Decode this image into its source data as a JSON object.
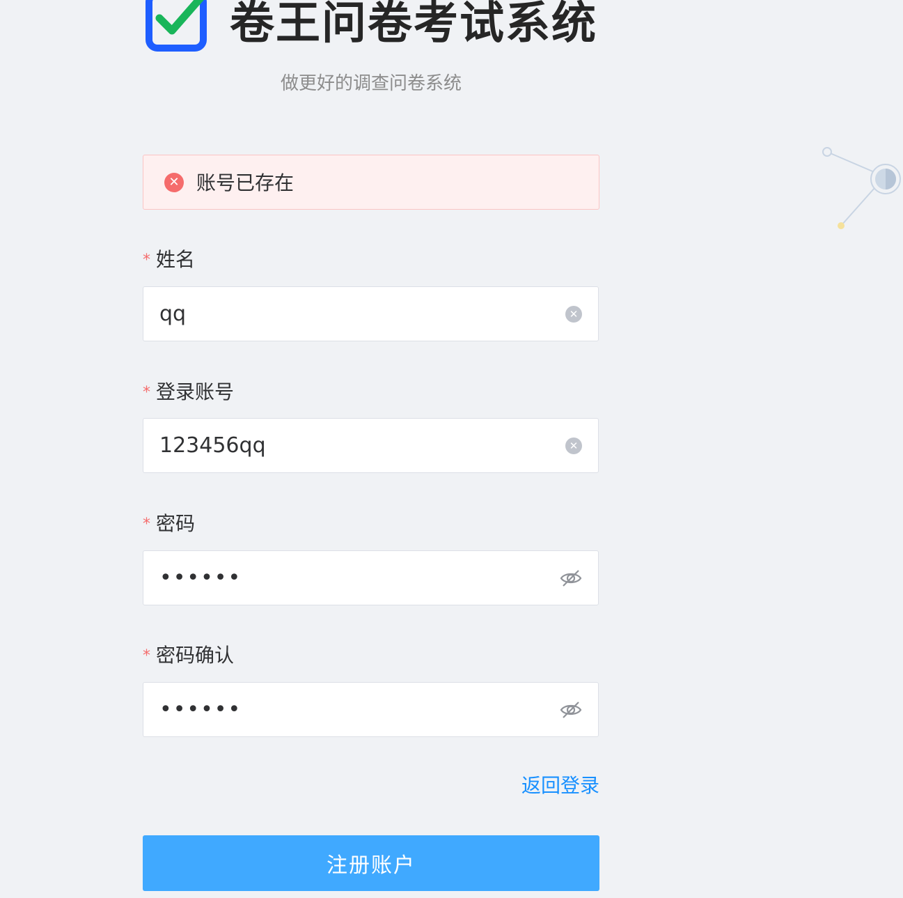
{
  "header": {
    "app_title": "卷王问卷考试系统",
    "subtitle": "做更好的调查问卷系统"
  },
  "alert": {
    "message": "账号已存在",
    "icon": "error-circle-icon",
    "color": "#f56c6c"
  },
  "form": {
    "required_mark": "*",
    "fields": [
      {
        "label": "姓名",
        "value": "qq",
        "type": "text",
        "suffix_icon": "clear-icon"
      },
      {
        "label": "登录账号",
        "value": "123456qq",
        "type": "text",
        "suffix_icon": "clear-icon"
      },
      {
        "label": "密码",
        "value": "••••••",
        "type": "password",
        "suffix_icon": "eye-off-icon"
      },
      {
        "label": "密码确认",
        "value": "••••••",
        "type": "password",
        "suffix_icon": "eye-off-icon"
      }
    ],
    "back_to_login": "返回登录",
    "submit_label": "注册账户"
  },
  "colors": {
    "background": "#f0f2f5",
    "primary": "#40a9ff",
    "link": "#1890ff",
    "error": "#f56c6c",
    "logo_blue": "#1e5eff",
    "logo_check": "#19b55a"
  }
}
